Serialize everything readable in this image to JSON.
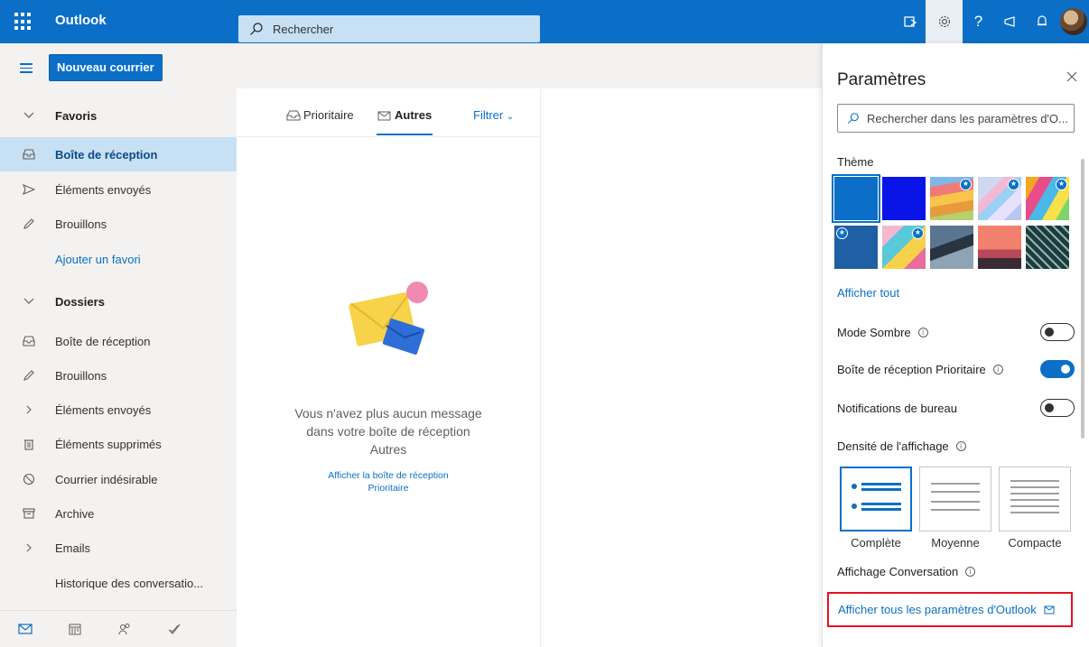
{
  "topbar": {
    "app_name": "Outlook",
    "search_placeholder": "Rechercher"
  },
  "toolbar": {
    "new_mail_label": "Nouveau courrier"
  },
  "nav": {
    "favorites_header": "Favoris",
    "favorites": [
      {
        "label": "Boîte de réception",
        "icon": "inbox-icon",
        "selected": true
      },
      {
        "label": "Éléments envoyés",
        "icon": "send-icon"
      },
      {
        "label": "Brouillons",
        "icon": "pencil-icon"
      }
    ],
    "add_favorite": "Ajouter un favori",
    "folders_header": "Dossiers",
    "folders": [
      {
        "label": "Boîte de réception",
        "icon": "inbox-icon"
      },
      {
        "label": "Brouillons",
        "icon": "pencil-icon"
      },
      {
        "label": "Éléments envoyés",
        "icon": "chevron-right-icon"
      },
      {
        "label": "Éléments supprimés",
        "icon": "trash-icon"
      },
      {
        "label": "Courrier indésirable",
        "icon": "block-icon"
      },
      {
        "label": "Archive",
        "icon": "archive-icon"
      },
      {
        "label": "Emails",
        "icon": "chevron-right-icon"
      },
      {
        "label": "Historique des conversatio...",
        "icon": ""
      }
    ]
  },
  "message_list": {
    "tabs": [
      "Prioritaire",
      "Autres"
    ],
    "active_tab": "Autres",
    "filter_label": "Filtrer",
    "empty_text": "Vous n'avez plus aucun message dans votre boîte de réception Autres",
    "empty_link": "Afficher la boîte de réception Prioritaire"
  },
  "settings": {
    "title": "Paramètres",
    "search_placeholder": "Rechercher dans les paramètres d'O...",
    "theme_label": "Thème",
    "show_all": "Afficher tout",
    "dark_mode": {
      "label": "Mode Sombre",
      "on": false
    },
    "focused_inbox": {
      "label": "Boîte de réception Prioritaire",
      "on": true
    },
    "desktop_notifications": {
      "label": "Notifications de bureau",
      "on": false
    },
    "density_label": "Densité de l'affichage",
    "density_options": [
      "Complète",
      "Moyenne",
      "Compacte"
    ],
    "density_selected": "Complète",
    "conversation_label": "Affichage Conversation",
    "all_settings_link": "Afficher tous les paramètres d'Outlook"
  },
  "colors": {
    "brand": "#0b6fc7",
    "highlight_border": "#e81123"
  }
}
